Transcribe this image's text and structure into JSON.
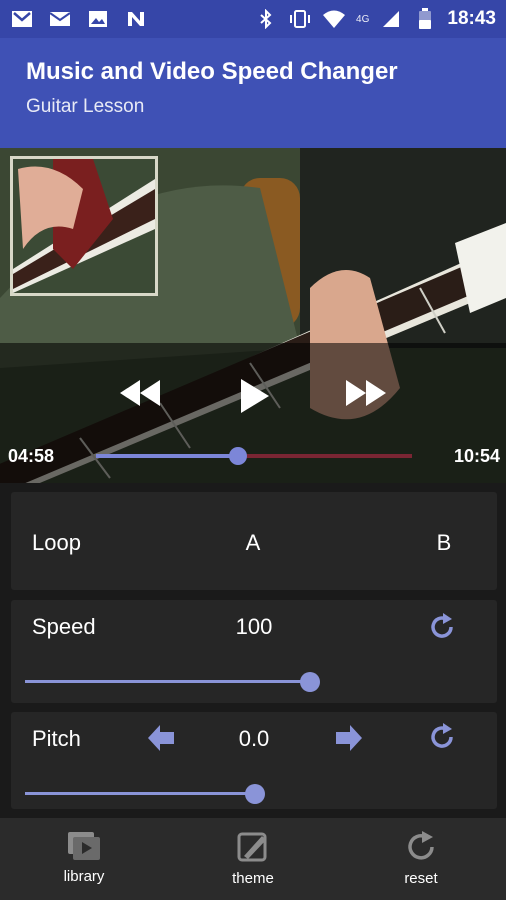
{
  "status_bar": {
    "time": "18:43",
    "network": "4G",
    "icons": [
      "gmail-icon",
      "mail-icon",
      "photo-icon",
      "notification-n-icon",
      "bluetooth-icon",
      "vibrate-icon",
      "wifi-icon",
      "signal-icon",
      "battery-icon"
    ]
  },
  "app_bar": {
    "title": "Music and Video Speed Changer",
    "subtitle": "Guitar Lesson"
  },
  "player": {
    "current_time": "04:58",
    "total_time": "10:54",
    "progress": 0.45
  },
  "loop": {
    "label": "Loop",
    "a_label": "A",
    "b_label": "B"
  },
  "speed": {
    "label": "Speed",
    "value": "100",
    "slider_level": 0.6
  },
  "pitch": {
    "label": "Pitch",
    "value": "0.0",
    "slider_level": 0.5
  },
  "bottom_nav": {
    "library": "library",
    "theme": "theme",
    "reset": "reset"
  },
  "colors": {
    "status_bar": "#3646a8",
    "app_bar": "#3f51b5",
    "accent": "#8a94d8",
    "seek_remaining": "#7a2533",
    "panel": "#262626",
    "background": "#1a1a1a"
  }
}
